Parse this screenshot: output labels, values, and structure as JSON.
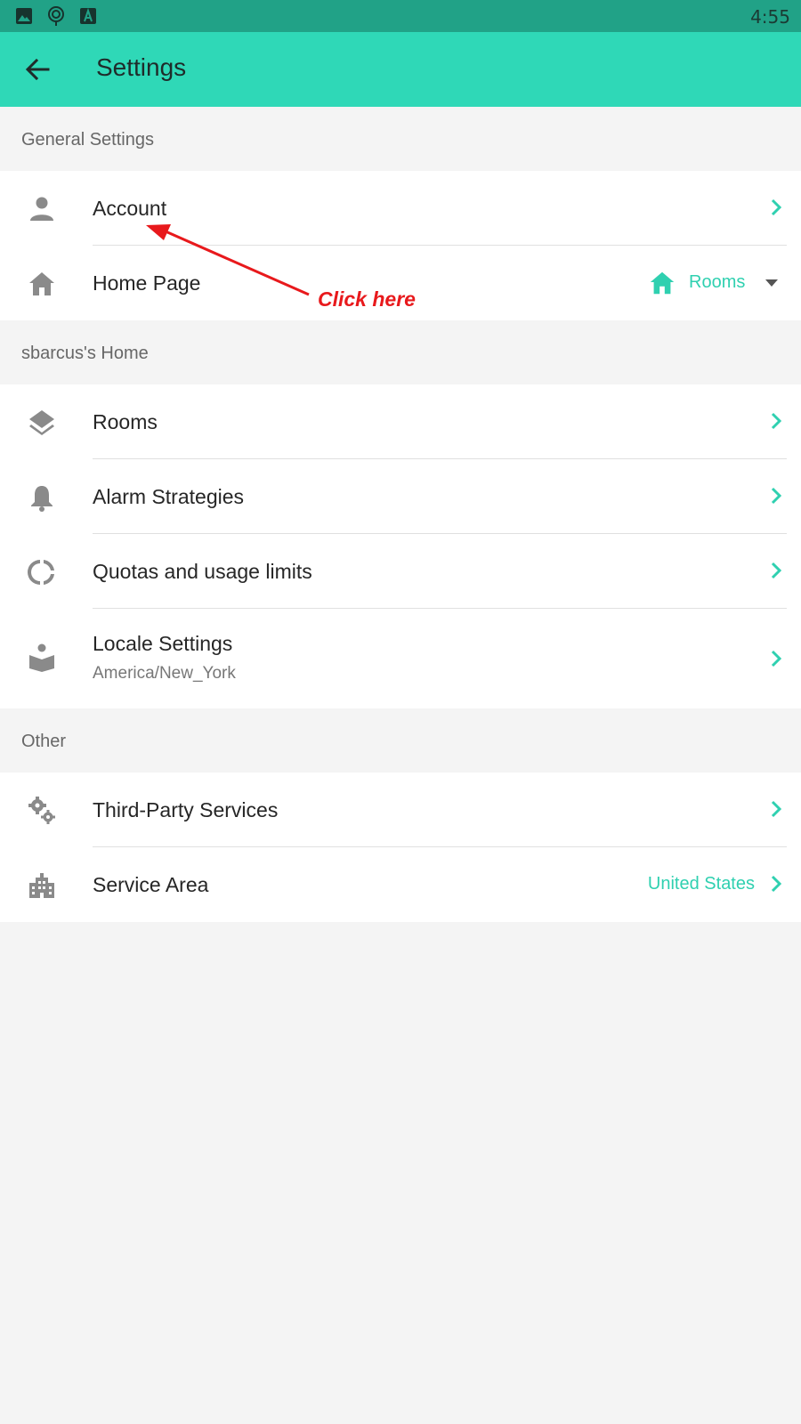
{
  "status_bar": {
    "time": "4:55",
    "icons": [
      "image-icon",
      "location-pin-icon",
      "font-a-icon"
    ]
  },
  "app_bar": {
    "title": "Settings",
    "back_icon": "arrow-back-icon"
  },
  "sections": {
    "general": {
      "header": "General Settings",
      "items": {
        "account": {
          "label": "Account",
          "icon": "person-icon"
        },
        "home_page": {
          "label": "Home Page",
          "icon": "home-icon",
          "value": "Rooms",
          "value_icon": "home-icon"
        }
      }
    },
    "home": {
      "header": "sbarcus's Home",
      "items": {
        "rooms": {
          "label": "Rooms",
          "icon": "layers-icon"
        },
        "alarm": {
          "label": "Alarm Strategies",
          "icon": "bell-icon"
        },
        "quotas": {
          "label": "Quotas and usage limits",
          "icon": "donut-icon"
        },
        "locale": {
          "label": "Locale Settings",
          "sublabel": "America/New_York",
          "icon": "book-reader-icon"
        }
      }
    },
    "other": {
      "header": "Other",
      "items": {
        "third_party": {
          "label": "Third-Party Services",
          "icon": "gears-icon"
        },
        "service_area": {
          "label": "Service Area",
          "icon": "city-icon",
          "value": "United States"
        }
      }
    }
  },
  "annotation": {
    "text": "Click here"
  },
  "colors": {
    "status_bar": "#21a287",
    "app_bar": "#2fd8b7",
    "accent": "#2fd0b0",
    "annotation": "#e8191c",
    "icon_gray": "#8a8a8a"
  }
}
